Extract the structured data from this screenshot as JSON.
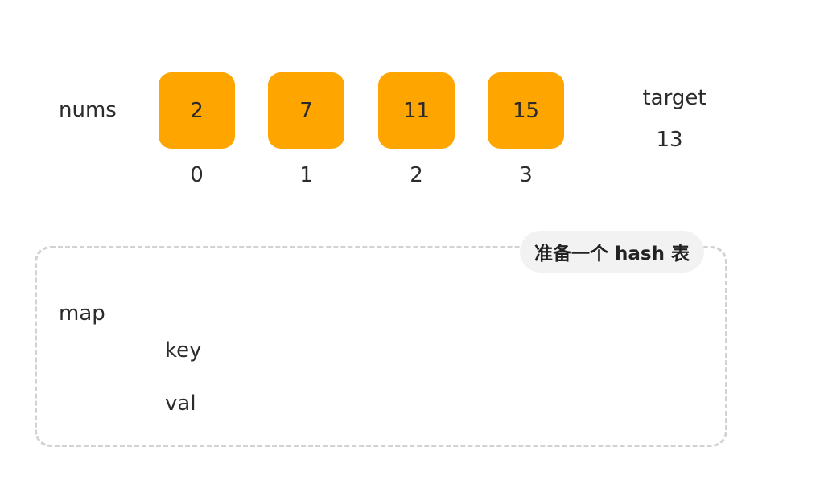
{
  "colors": {
    "cell_fill": "#FFA500",
    "dashed_border": "#D2D2D2",
    "badge_bg": "#F2F2F2",
    "text": "#2B2B2B"
  },
  "nums": {
    "label": "nums",
    "values": [
      "2",
      "7",
      "11",
      "15"
    ],
    "indices": [
      "0",
      "1",
      "2",
      "3"
    ]
  },
  "target": {
    "label": "target",
    "value": "13"
  },
  "map": {
    "badge": "准备一个 hash 表",
    "label": "map",
    "key_label": "key",
    "val_label": "val"
  }
}
